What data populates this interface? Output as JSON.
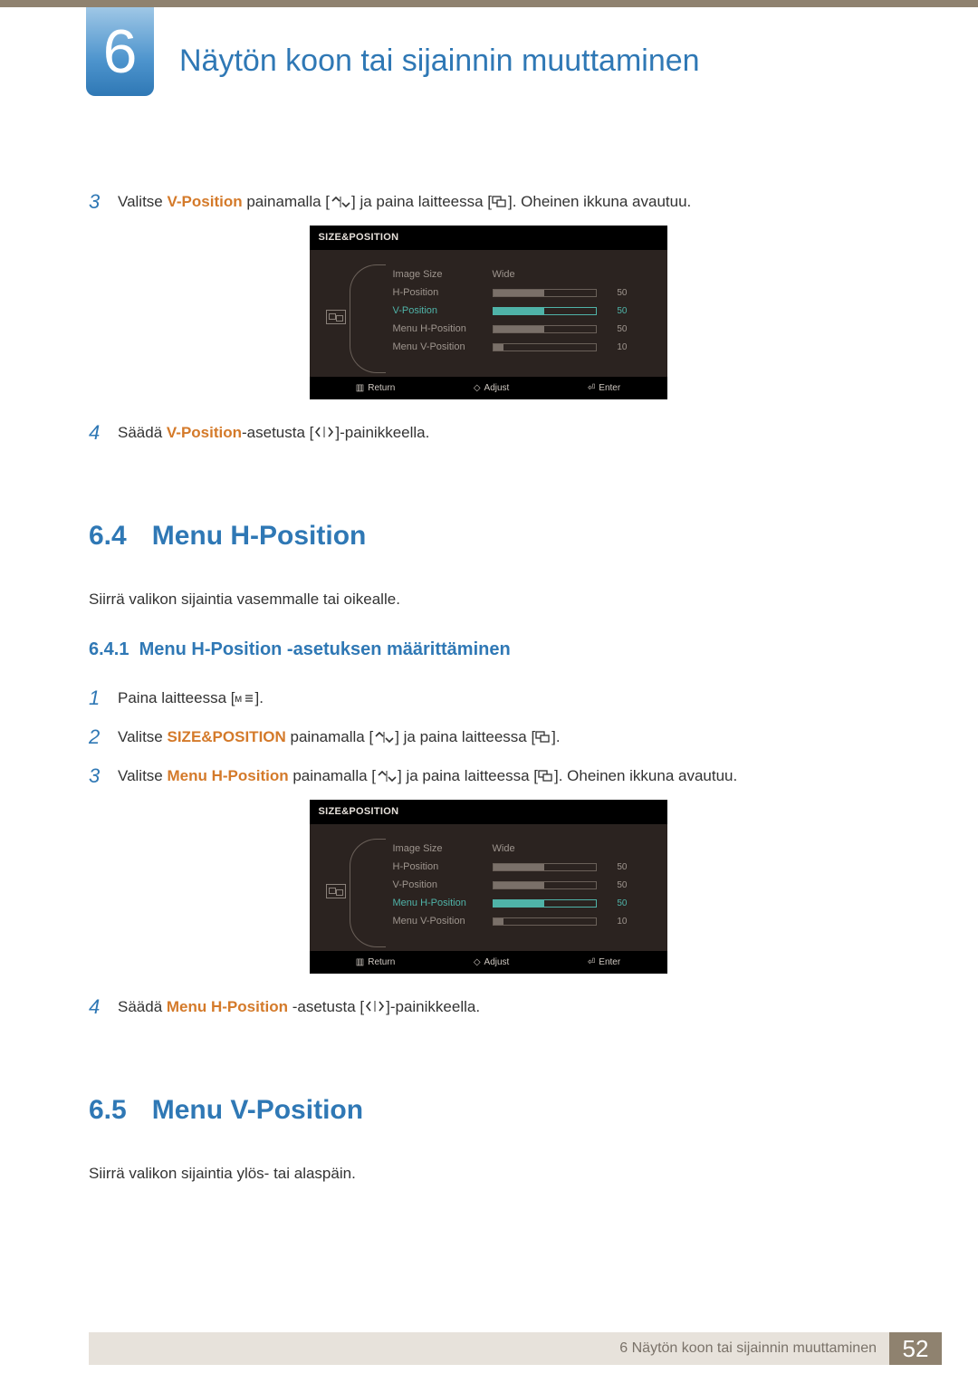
{
  "chapter": {
    "number": "6",
    "title": "Näytön koon tai sijainnin muuttaminen"
  },
  "step3a": {
    "num": "3",
    "t1": "Valitse ",
    "kw": "V-Position",
    "t2": " painamalla [",
    "t3": "] ja paina laitteessa [",
    "t4": "]. Oheinen ikkuna avautuu."
  },
  "step4a": {
    "num": "4",
    "t1": "Säädä ",
    "kw": "V-Position",
    "t2": "-asetusta [",
    "t3": "]-painikkeella."
  },
  "sec64": {
    "num": "6.4",
    "title": "Menu H-Position"
  },
  "para64": "Siirrä valikon sijaintia vasemmalle tai oikealle.",
  "sub641": {
    "num": "6.4.1",
    "title": "Menu H-Position -asetuksen määrittäminen"
  },
  "s641_1": {
    "num": "1",
    "t1": "Paina laitteessa [",
    "t2": "]."
  },
  "s641_2": {
    "num": "2",
    "t1": "Valitse ",
    "kw": "SIZE&POSITION",
    "t2": " painamalla [",
    "t3": "] ja paina laitteessa [",
    "t4": "]."
  },
  "s641_3": {
    "num": "3",
    "t1": "Valitse ",
    "kw": "Menu H-Position",
    "t2": " painamalla [",
    "t3": "] ja paina laitteessa [",
    "t4": "]. Oheinen ikkuna avautuu."
  },
  "step4b": {
    "num": "4",
    "t1": "Säädä ",
    "kw": "Menu H-Position",
    "t2": " -asetusta [",
    "t3": "]-painikkeella."
  },
  "sec65": {
    "num": "6.5",
    "title": "Menu V-Position"
  },
  "para65": "Siirrä valikon sijaintia ylös- tai alaspäin.",
  "osd": {
    "title": "SIZE&POSITION",
    "labels": {
      "imageSize": "Image Size",
      "hpos": "H-Position",
      "vpos": "V-Position",
      "mhpos": "Menu H-Position",
      "mvpos": "Menu V-Position"
    },
    "wide": "Wide",
    "values": {
      "hpos": "50",
      "vpos": "50",
      "mhpos": "50",
      "mvpos": "10"
    },
    "footer": {
      "return": "Return",
      "adjust": "Adjust",
      "enter": "Enter"
    }
  },
  "footer": {
    "text": "6 Näytön koon tai sijainnin muuttaminen",
    "page": "52"
  }
}
